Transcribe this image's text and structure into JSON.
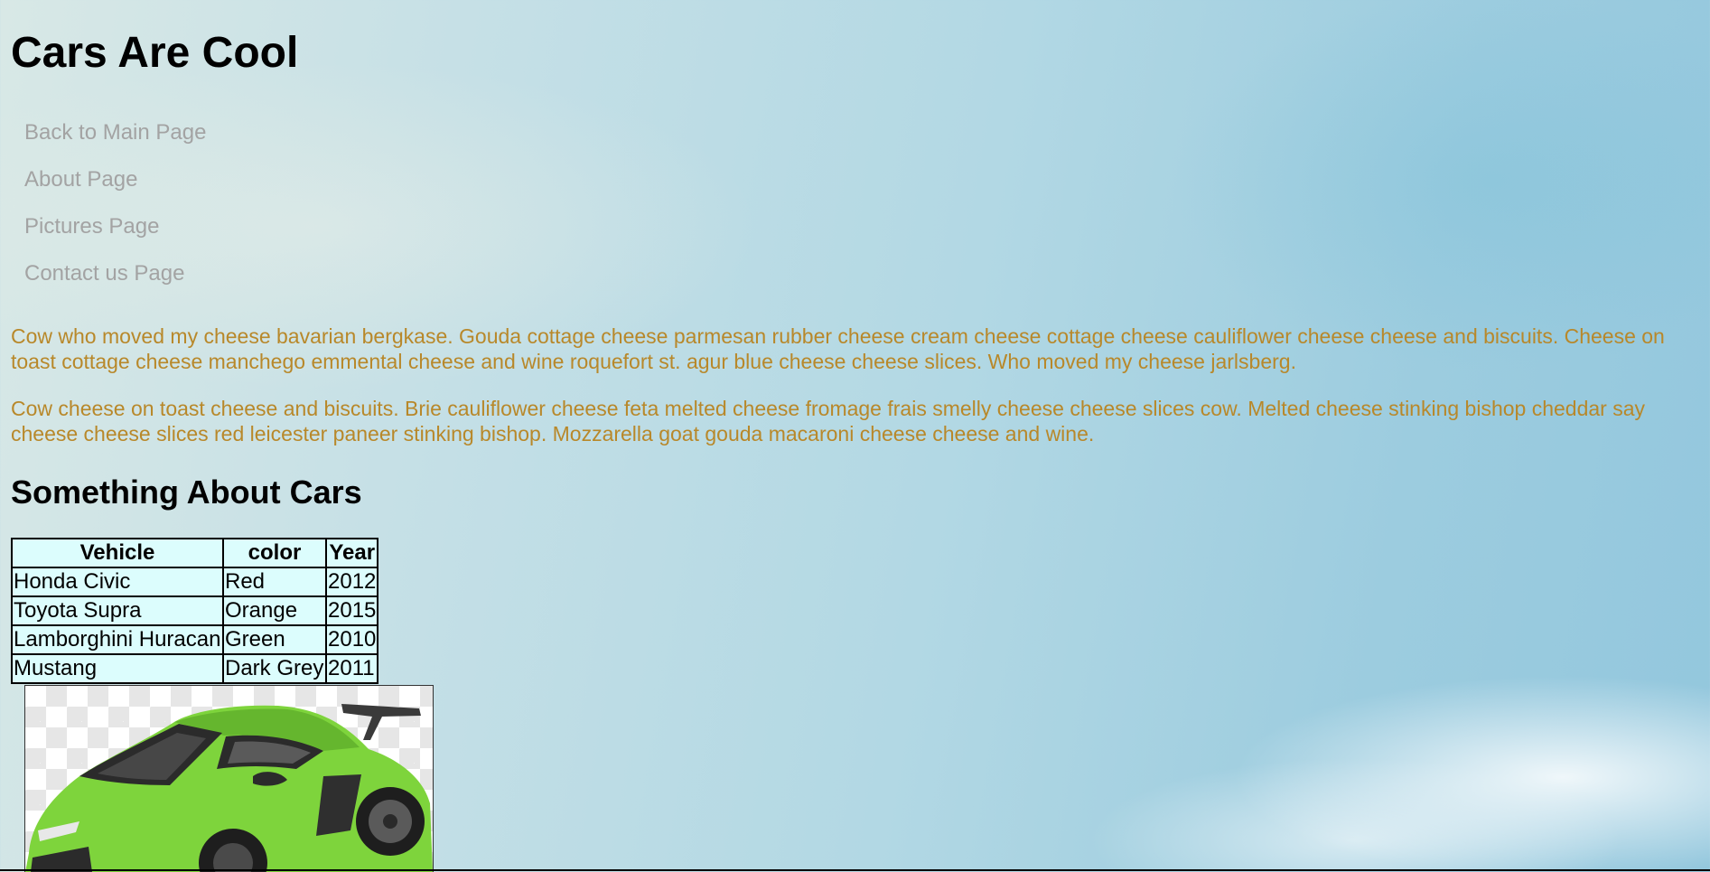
{
  "page": {
    "title": "Cars Are Cool",
    "subtitle": "Something About Cars"
  },
  "nav": {
    "items": [
      {
        "label": "Back to Main Page"
      },
      {
        "label": "About Page"
      },
      {
        "label": "Pictures Page"
      },
      {
        "label": "Contact us Page"
      }
    ]
  },
  "paragraphs": [
    "Cow who moved my cheese bavarian bergkase. Gouda cottage cheese parmesan rubber cheese cream cheese cottage cheese cauliflower cheese cheese and biscuits. Cheese on toast cottage cheese manchego emmental cheese and wine roquefort st. agur blue cheese cheese slices. Who moved my cheese jarlsberg.",
    "Cow cheese on toast cheese and biscuits. Brie cauliflower cheese feta melted cheese fromage frais smelly cheese cheese slices cow. Melted cheese stinking bishop cheddar say cheese cheese slices red leicester paneer stinking bishop. Mozzarella goat gouda macaroni cheese cheese and wine."
  ],
  "table": {
    "headers": [
      "Vehicle",
      "color",
      "Year"
    ],
    "rows": [
      [
        "Honda Civic",
        "Red",
        "2012"
      ],
      [
        "Toyota Supra",
        "Orange",
        "2015"
      ],
      [
        "Lamborghini Huracan",
        "Green",
        "2010"
      ],
      [
        "Mustang",
        "Dark Grey",
        "2011"
      ]
    ]
  },
  "image": {
    "icon": "green-sports-car-image"
  },
  "colors": {
    "paragraph_text": "#b8882a",
    "nav_link": "#a3a3a3",
    "table_background": "#dcfdfd",
    "car_body": "#7ed43c"
  }
}
